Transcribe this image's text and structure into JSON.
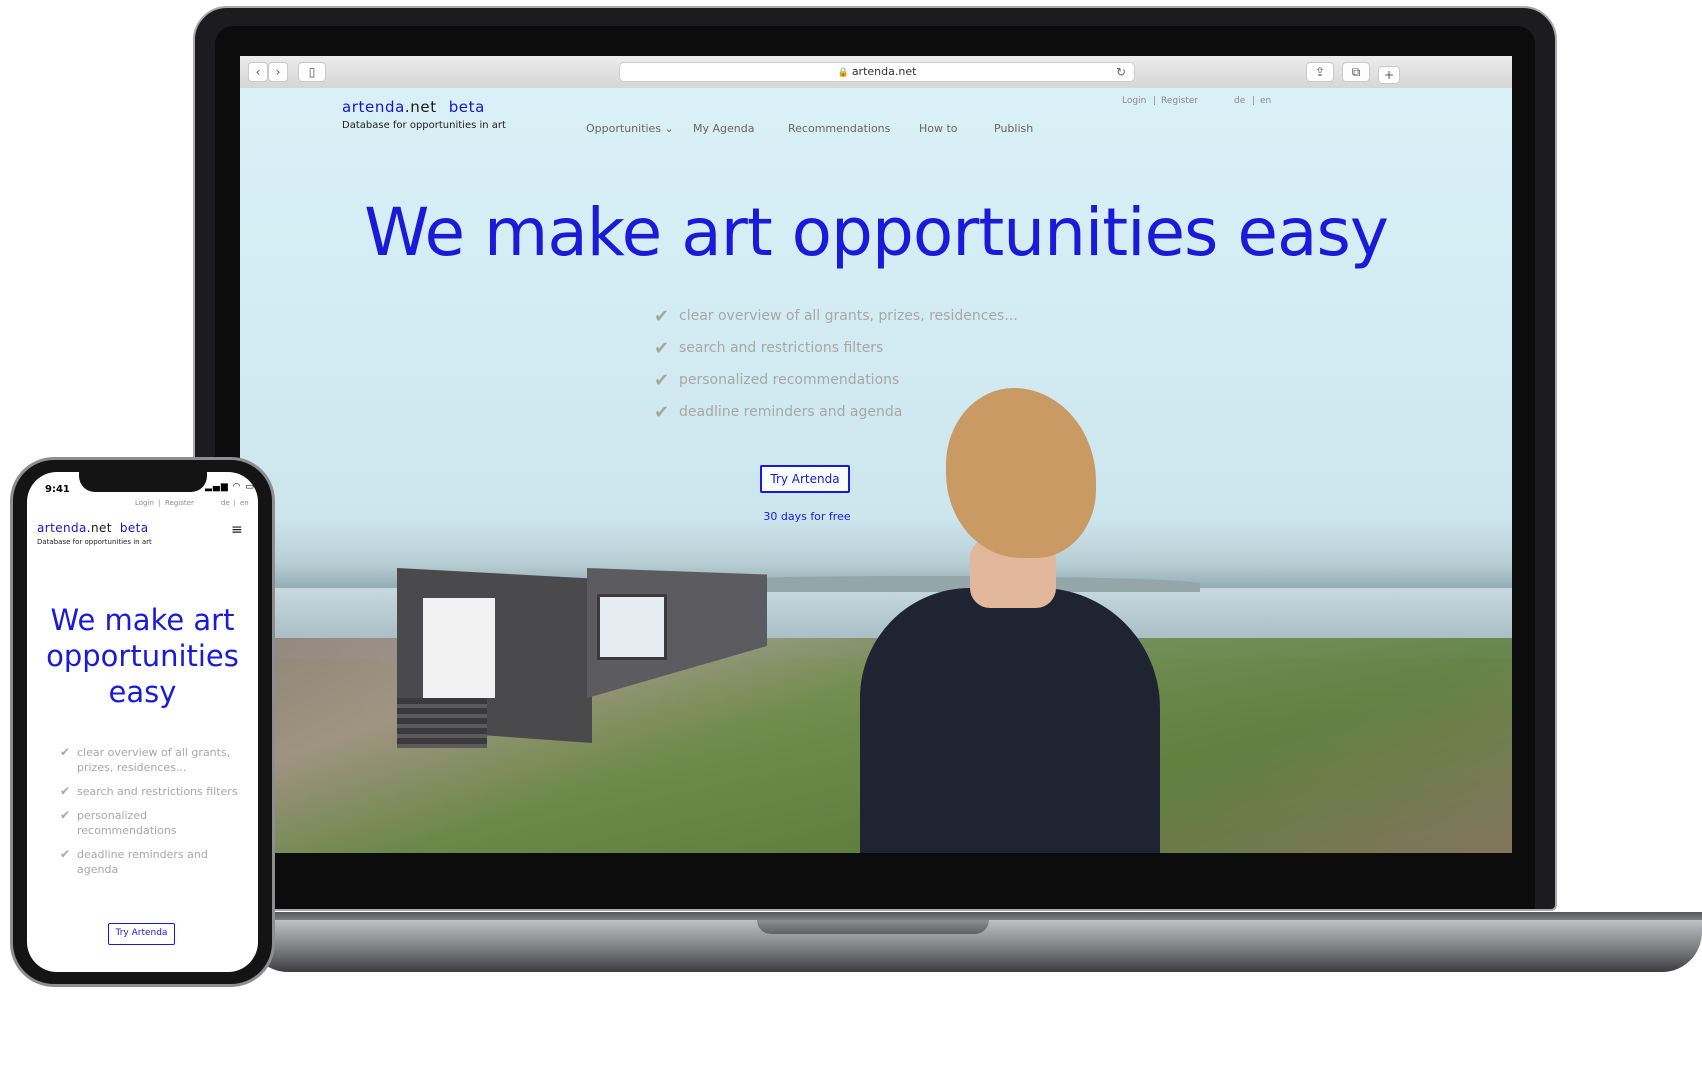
{
  "browser": {
    "url": "artenda.net",
    "back_icon": "‹",
    "forward_icon": "›",
    "sidebar_icon": "▯",
    "share_icon": "⇪",
    "tabs_icon": "⧉",
    "new_tab_icon": "+",
    "reload_icon": "↻",
    "lock_icon": "🔒"
  },
  "site": {
    "brand_part1": "artenda",
    "brand_part2": ".net",
    "beta": "beta",
    "tagline": "Database for opportunities in art",
    "login": "Login",
    "register": "Register",
    "lang_de": "de",
    "lang_en": "en",
    "separator": "|",
    "nav": [
      "Opportunities ⌄",
      "My Agenda",
      "Recommendations",
      "How to",
      "Publish"
    ],
    "hero": "We make art opportunities easy",
    "features": [
      "clear overview of all grants, prizes, residences...",
      "search and restrictions filters",
      "personalized recommendations",
      "deadline reminders and agenda"
    ],
    "check_icon": "✔",
    "cta": "Try Artenda",
    "trial": "30 days for free"
  },
  "phone": {
    "time": "9:41",
    "status": "▂▄▆ ◠ ▭",
    "menu_icon": "≡",
    "hero_line1": "We make art",
    "hero_line2": "opportunities",
    "hero_line3": "easy",
    "features": [
      "clear overview of all grants, prizes, residences...",
      "search and restrictions filters",
      "personalized recommendations",
      "deadline reminders and agenda"
    ]
  },
  "colors": {
    "accent": "#1a1ad9",
    "muted": "#a7a7a7"
  }
}
